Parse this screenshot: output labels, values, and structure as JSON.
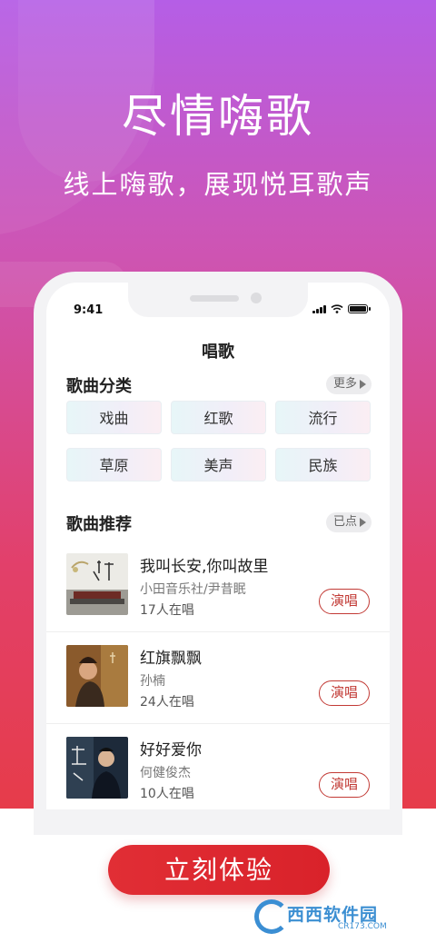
{
  "hero": {
    "headline": "尽情嗨歌",
    "subheadline": "线上嗨歌，展现悦耳歌声"
  },
  "status_bar": {
    "time": "9:41",
    "icons": [
      "cellular-signal-icon",
      "wifi-icon",
      "battery-icon"
    ]
  },
  "page": {
    "title": "唱歌"
  },
  "categories": {
    "title": "歌曲分类",
    "more_label": "更多",
    "items": [
      "戏曲",
      "红歌",
      "流行",
      "草原",
      "美声",
      "民族"
    ]
  },
  "recommend": {
    "title": "歌曲推荐",
    "selected_label": "已点",
    "songs": [
      {
        "name": "我叫长安,你叫故里",
        "artist": "小田音乐社/尹昔眠",
        "count": "17人在唱",
        "action": "演唱"
      },
      {
        "name": "红旗飘飘",
        "artist": "孙楠",
        "count": "24人在唱",
        "action": "演唱"
      },
      {
        "name": "好好爱你",
        "artist": "何健俊杰",
        "count": "10人在唱",
        "action": "演唱"
      }
    ]
  },
  "cta": {
    "label": "立刻体验"
  },
  "watermark": {
    "text": "西西软件园",
    "sub": "CR173.COM"
  },
  "colors": {
    "accent": "#c23a35",
    "cta": "#e12e35",
    "hero_top": "#b55ee6",
    "hero_bottom": "#e63c4a"
  }
}
